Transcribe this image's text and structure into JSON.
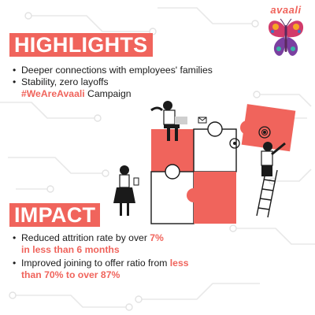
{
  "brand": {
    "logo_text": "avaali"
  },
  "highlights": {
    "heading": "HIGHLIGHTS",
    "items": [
      {
        "text": "Deeper connections with employees' families"
      },
      {
        "text": "Stability, zero layoffs"
      }
    ],
    "campaign_tag": "#WeAreAvaali",
    "campaign_suffix": " Campaign"
  },
  "impact": {
    "heading": "IMPACT",
    "items": [
      {
        "prefix": "Reduced attrition rate by over ",
        "highlight": "7%",
        "highlight2": "in less than 6 months",
        "suffix": ""
      },
      {
        "prefix": "Improved joining to offer ratio from ",
        "highlight": "less",
        "highlight2": "than 70% to over 87%",
        "suffix": ""
      }
    ]
  },
  "colors": {
    "accent": "#f0645c",
    "text": "#1a1a1a",
    "circuit": "#e6e6e6"
  },
  "illustration": {
    "name": "puzzle-teamwork-illustration"
  }
}
